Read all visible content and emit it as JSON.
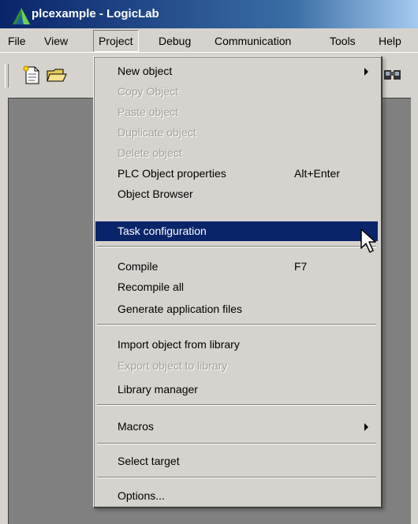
{
  "window": {
    "title": "plcexample - LogicLab"
  },
  "menubar": {
    "items": [
      "File",
      "View",
      "Project",
      "Debug",
      "Communication",
      "Tools",
      "Help"
    ],
    "open": "Project"
  },
  "toolbar": {
    "icons": [
      "new-file-icon",
      "open-folder-icon",
      "find-icon"
    ]
  },
  "project_menu": {
    "items": [
      {
        "label": "New object",
        "submenu": true,
        "enabled": true
      },
      {
        "label": "Copy Object",
        "enabled": false
      },
      {
        "label": "Paste object",
        "enabled": false
      },
      {
        "label": "Duplicate object",
        "enabled": false
      },
      {
        "label": "Delete object",
        "enabled": false
      },
      {
        "label": "PLC Object properties",
        "shortcut": "Alt+Enter",
        "enabled": true
      },
      {
        "label": "Object Browser",
        "enabled": true
      },
      {
        "label": "Task configuration",
        "enabled": true,
        "highlighted": true
      },
      {
        "label": "Compile",
        "shortcut": "F7",
        "enabled": true
      },
      {
        "label": "Recompile all",
        "enabled": true
      },
      {
        "label": "Generate application files",
        "enabled": true
      },
      {
        "label": "Import object from library",
        "enabled": true
      },
      {
        "label": "Export object to library",
        "enabled": false
      },
      {
        "label": "Library manager",
        "enabled": true
      },
      {
        "label": "Macros",
        "submenu": true,
        "enabled": true
      },
      {
        "label": "Select target",
        "enabled": true
      },
      {
        "label": "Options...",
        "enabled": true
      }
    ]
  },
  "colors": {
    "titlebar_start": "#0a246a",
    "titlebar_end": "#a6caf0",
    "menu_highlight": "#0a246a",
    "face": "#d6d3ce",
    "workspace": "#808080",
    "disabled_text": "#a3a09a"
  }
}
